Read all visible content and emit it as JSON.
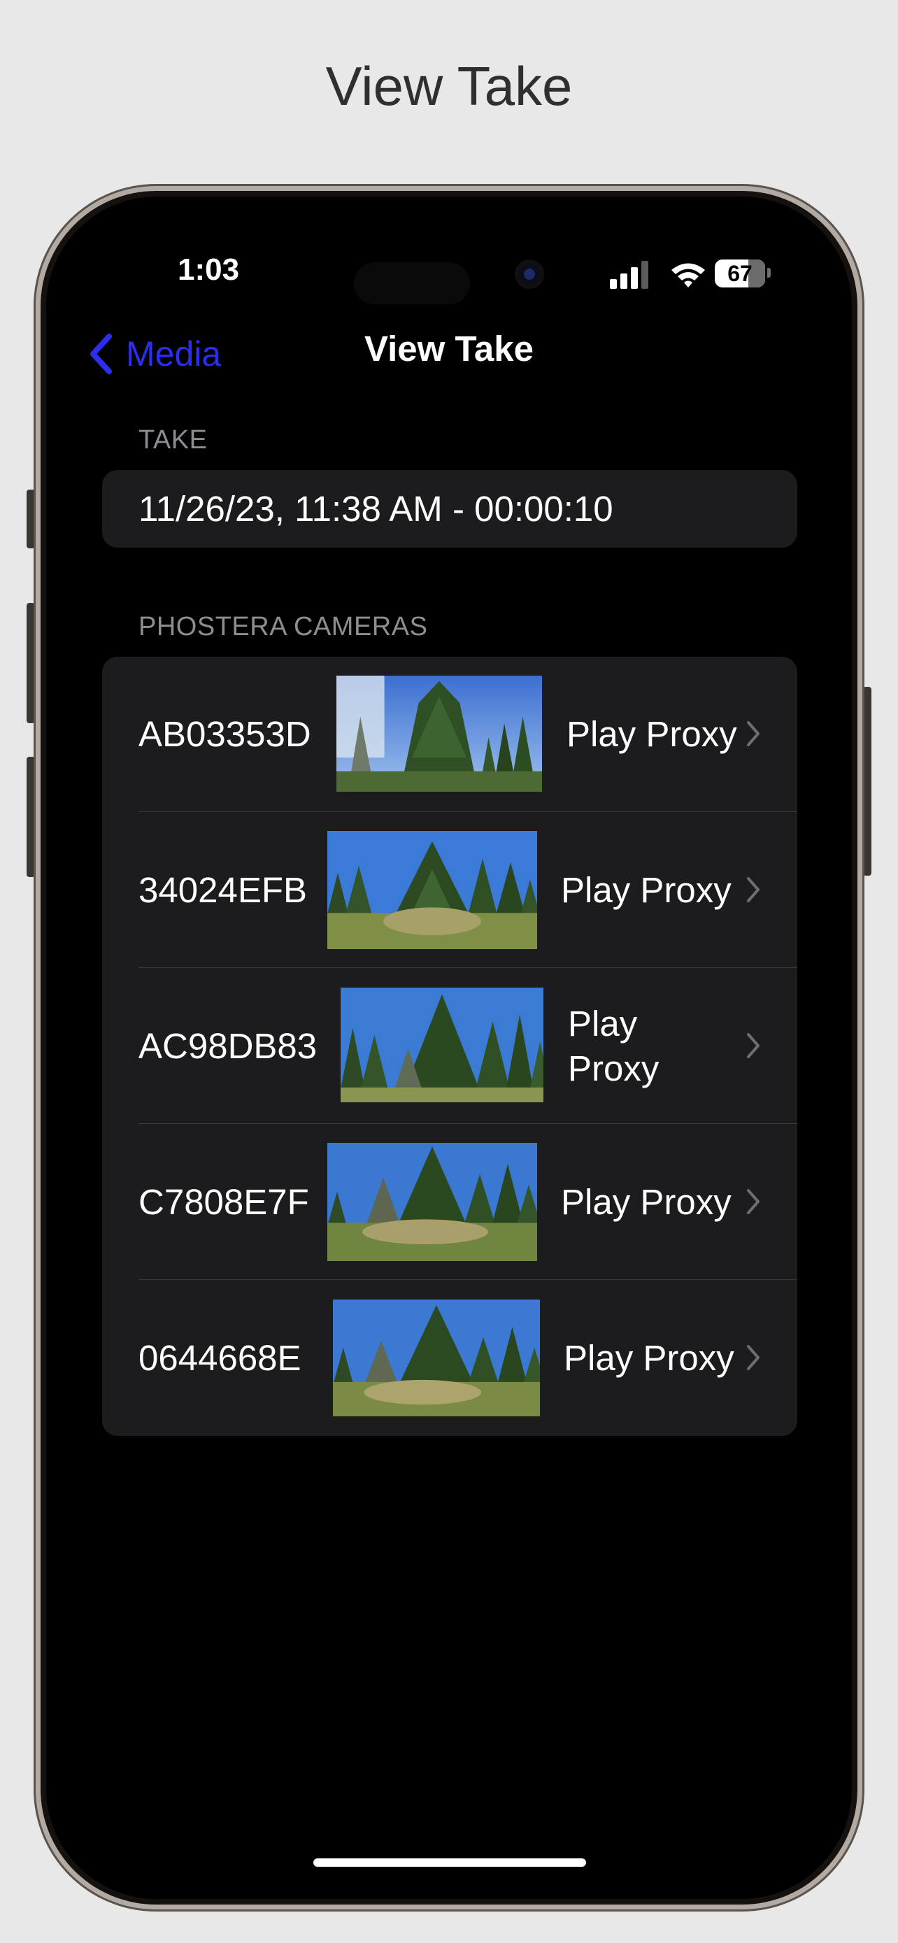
{
  "page_heading": "View Take",
  "status_bar": {
    "time": "1:03",
    "battery": "67"
  },
  "nav": {
    "back_label": "Media",
    "title": "View Take"
  },
  "take_section": {
    "header": "TAKE",
    "value": "11/26/23, 11:38 AM - 00:00:10"
  },
  "cameras_section": {
    "header": "PHOSTERA CAMERAS",
    "rows": [
      {
        "id": "AB03353D",
        "action": "Play Proxy"
      },
      {
        "id": "34024EFB",
        "action": "Play Proxy"
      },
      {
        "id": "AC98DB83",
        "action": "Play Proxy"
      },
      {
        "id": "C7808E7F",
        "action": "Play Proxy"
      },
      {
        "id": "0644668E",
        "action": "Play Proxy"
      }
    ]
  },
  "colors": {
    "accent": "#2d2df0",
    "card_background": "#1c1c1e",
    "secondary_text": "#8d8d93"
  },
  "icons": [
    "back-chevron-icon",
    "signal-icon",
    "wifi-icon",
    "battery-icon",
    "chevron-right-icon"
  ]
}
